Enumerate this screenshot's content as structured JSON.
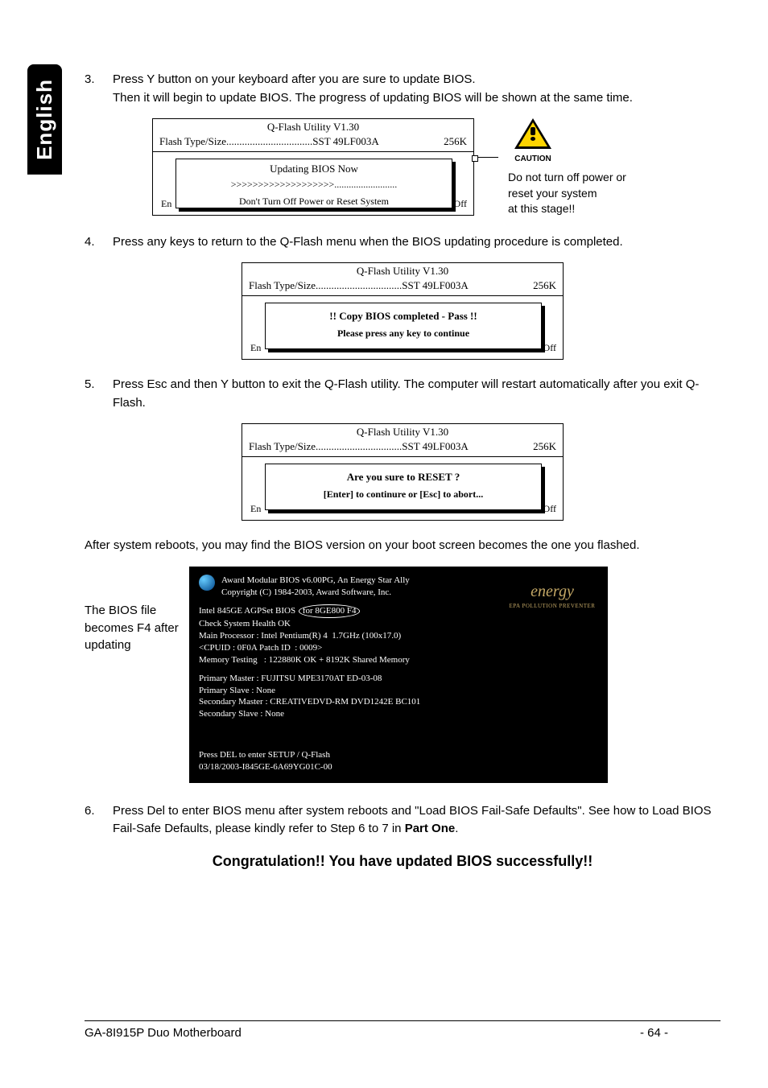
{
  "sideTab": "English",
  "steps": {
    "s3": {
      "num": "3.",
      "line1": "Press Y button on your keyboard after you are sure to update BIOS.",
      "line2": "Then it will begin to update BIOS. The progress of updating BIOS will be shown at the same time."
    },
    "s4": {
      "num": "4.",
      "line1": "Press any keys to return to the Q-Flash menu when the BIOS updating procedure is completed."
    },
    "s5": {
      "num": "5.",
      "line1": "Press Esc and then Y button to exit the Q-Flash utility. The computer will restart automatically after you exit Q-Flash."
    },
    "s6": {
      "num": "6.",
      "line1": "Press Del to enter BIOS menu after system reboots and \"Load BIOS Fail-Safe Defaults\". See how to Load BIOS Fail-Safe Defaults, please kindly refer to Step 6 to 7 in ",
      "bold": "Part One",
      "tail": "."
    }
  },
  "qflash": {
    "title": "Q-Flash Utility V1.30",
    "typeLabel": "Flash Type/Size.................................SST 49LF003A",
    "size": "256K",
    "bgEnter": "En",
    "bgOff": "er Off",
    "box1": {
      "l1": "Updating BIOS Now",
      "l2": ">>>>>>>>>>>>>>>>>>>..........................",
      "foot": "Don't Turn Off Power or Reset System"
    },
    "box2": {
      "l1": "!! Copy BIOS completed - Pass !!",
      "l2": "Please press any key to continue"
    },
    "box3": {
      "l1": "Are you sure to RESET ?",
      "l2": "[Enter] to continure or [Esc] to abort..."
    }
  },
  "caution": {
    "label": "CAUTION",
    "l1": "Do not turn off power or",
    "l2": "reset your system",
    "l3": "at this stage!!"
  },
  "afterPara": "After system reboots, you may find the BIOS version on your boot screen becomes the one you flashed.",
  "bootNote": "The BIOS file becomes F4 after updating",
  "boot": {
    "hdr1": "Award Modular BIOS v6.00PG, An Energy Star Ally",
    "hdr2": "Copyright  (C) 1984-2003, Award Software,  Inc.",
    "energy": "energy",
    "energySub": "EPA  POLLUTION PREVENTER",
    "b1a": "Intel 845GE AGPSet BIOS ",
    "b1circ": "for 8GE800 F4",
    "b2": "Check System Health OK",
    "b3": "Main Processor : Intel Pentium(R) 4  1.7GHz (100x17.0)",
    "b4": "<CPUID : 0F0A Patch ID  : 0009>",
    "b5": "Memory Testing   : 122880K OK + 8192K Shared Memory",
    "b6": "Primary Master : FUJITSU MPE3170AT ED-03-08",
    "b7": "Primary Slave : None",
    "b8": "Secondary Master : CREATIVEDVD-RM DVD1242E BC101",
    "b9": "Secondary Slave : None",
    "f1": "Press DEL to enter SETUP / Q-Flash",
    "f2": "03/18/2003-I845GE-6A69YG01C-00"
  },
  "congrats": "Congratulation!! You have updated BIOS successfully!!",
  "footer": {
    "left": "GA-8I915P Duo Motherboard",
    "mid": "- 64 -"
  }
}
